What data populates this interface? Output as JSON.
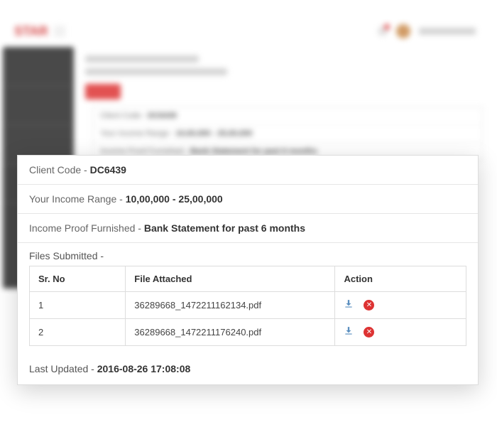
{
  "bg_panel": {
    "client_code_label": "Client Code - ",
    "client_code_value": "DC6439",
    "income_range_label": "Your Income Range - ",
    "income_range_value": "10,00,000 - 25,00,000",
    "income_proof_label": "Income Proof Furnished - ",
    "income_proof_value": "Bank Statement for past 6 months"
  },
  "card": {
    "client_code_label": "Client Code - ",
    "client_code_value": "DC6439",
    "income_range_label": "Your Income Range - ",
    "income_range_value": "10,00,000 - 25,00,000",
    "income_proof_label": "Income Proof Furnished - ",
    "income_proof_value": "Bank Statement for past 6 months",
    "files_label": "Files Submitted -",
    "table": {
      "headers": {
        "sr": "Sr. No",
        "file": "File Attached",
        "action": "Action"
      },
      "rows": [
        {
          "sr": "1",
          "file": "36289668_1472211162134.pdf"
        },
        {
          "sr": "2",
          "file": "36289668_1472211176240.pdf"
        }
      ]
    },
    "last_updated_label": "Last Updated - ",
    "last_updated_value": "2016-08-26 17:08:08"
  }
}
